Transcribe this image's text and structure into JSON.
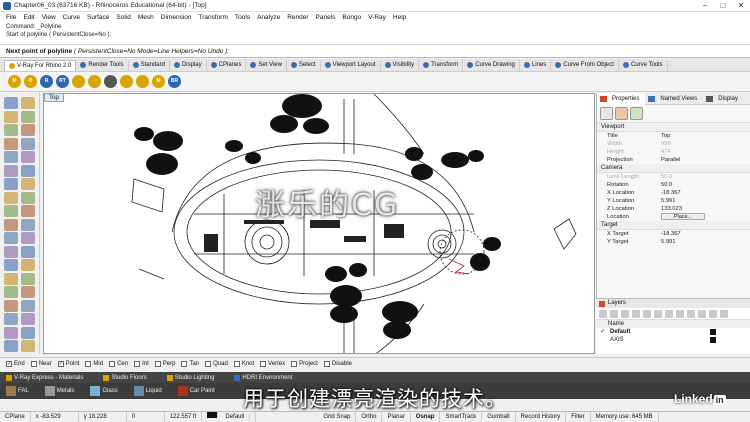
{
  "window": {
    "title": "Chapter06_03 (63716 KB) - Rhinoceros Educational (64-bit) - [Top]"
  },
  "menu": [
    "File",
    "Edit",
    "View",
    "Curve",
    "Surface",
    "Solid",
    "Mesh",
    "Dimension",
    "Transform",
    "Tools",
    "Analyze",
    "Render",
    "Panels",
    "Bongo",
    "V-Ray",
    "Help"
  ],
  "command_history": [
    "Command: _Polyline",
    "Start of polyline ( PersistentClose=No ):"
  ],
  "prompt": {
    "label": "Next point of polyline",
    "options": "( PersistentClose=No  Mode=Line  Helpers=No  Undo ):"
  },
  "toolbar_tabs": [
    {
      "label": "V-Ray For Rhino 2.0",
      "color": "#d9a400"
    },
    {
      "label": "Render Tools",
      "color": "#3a6fb5"
    },
    {
      "label": "Standard",
      "color": "#3a6fb5"
    },
    {
      "label": "Display",
      "color": "#3a6fb5"
    },
    {
      "label": "CPlanes",
      "color": "#3a6fb5"
    },
    {
      "label": "Set View",
      "color": "#3a6fb5"
    },
    {
      "label": "Select",
      "color": "#3a6fb5"
    },
    {
      "label": "Viewport Layout",
      "color": "#3a6fb5"
    },
    {
      "label": "Visibility",
      "color": "#3a6fb5"
    },
    {
      "label": "Transform",
      "color": "#3a6fb5"
    },
    {
      "label": "Curve Drawing",
      "color": "#3a6fb5"
    },
    {
      "label": "Lines",
      "color": "#3a6fb5"
    },
    {
      "label": "Curve From Object",
      "color": "#3a6fb5"
    },
    {
      "label": "Curve Tools",
      "color": "#3a6fb5"
    }
  ],
  "vray_icons": [
    {
      "label": "M",
      "color": "#d9a400"
    },
    {
      "label": "O",
      "color": "#d9a400"
    },
    {
      "label": "R",
      "color": "#2d68b3"
    },
    {
      "label": "RT",
      "color": "#2d68b3"
    },
    {
      "label": "",
      "color": "#d9a400"
    },
    {
      "label": "",
      "color": "#d9a400"
    },
    {
      "label": "",
      "color": "#555555"
    },
    {
      "label": "",
      "color": "#d9a400"
    },
    {
      "label": "",
      "color": "#d9a400"
    },
    {
      "label": "M",
      "color": "#d9a400"
    },
    {
      "label": "BR",
      "color": "#2d68b3"
    }
  ],
  "viewport": {
    "name": "Top"
  },
  "watermark": "涨乐的CG",
  "properties": {
    "tabs": [
      "Properties",
      "Named Views",
      "Display"
    ],
    "viewport_section": "Viewport",
    "viewport_rows": [
      {
        "k": "Title",
        "v": "Top",
        "dis": false
      },
      {
        "k": "Width",
        "v": "999",
        "dis": true
      },
      {
        "k": "Height",
        "v": "474",
        "dis": true
      },
      {
        "k": "Projection",
        "v": "Parallel",
        "dis": false
      }
    ],
    "camera_section": "Camera",
    "camera_rows": [
      {
        "k": "Lens Length",
        "v": "50.0",
        "dis": true
      },
      {
        "k": "Rotation",
        "v": "50.0",
        "dis": false
      },
      {
        "k": "X Location",
        "v": "-18.367",
        "dis": false
      },
      {
        "k": "Y Location",
        "v": "5.991",
        "dis": false
      },
      {
        "k": "Z Location",
        "v": "133.023",
        "dis": false
      }
    ],
    "location_label": "Location",
    "place_button": "Place...",
    "target_section": "Target",
    "target_rows": [
      {
        "k": "X Target",
        "v": "-18.367",
        "dis": false
      },
      {
        "k": "Y Target",
        "v": "5.991",
        "dis": false
      }
    ]
  },
  "layers": {
    "title": "Layers",
    "col": "Name",
    "rows": [
      {
        "name": "Default",
        "bold": true,
        "check": "✓"
      },
      {
        "name": "AXIS",
        "bold": false,
        "check": ""
      }
    ]
  },
  "osnaps": [
    {
      "label": "End",
      "checked": true
    },
    {
      "label": "Near",
      "checked": false
    },
    {
      "label": "Point",
      "checked": true
    },
    {
      "label": "Mid",
      "checked": false
    },
    {
      "label": "Cen",
      "checked": false
    },
    {
      "label": "Int",
      "checked": false
    },
    {
      "label": "Perp",
      "checked": false
    },
    {
      "label": "Tan",
      "checked": false
    },
    {
      "label": "Quad",
      "checked": false
    },
    {
      "label": "Knot",
      "checked": false
    },
    {
      "label": "Vertex",
      "checked": false
    },
    {
      "label": "Project",
      "checked": false
    },
    {
      "label": "Disable",
      "checked": false
    }
  ],
  "material_tabs": [
    {
      "label": "V-Ray Express - Materials",
      "color": "#d9a400"
    },
    {
      "label": "Studio Floors",
      "color": "#d9a400"
    },
    {
      "label": "Studio Lighting",
      "color": "#d9a400"
    },
    {
      "label": "HDRI Environment",
      "color": "#3a6fb5"
    }
  ],
  "materials": [
    {
      "label": "FAL",
      "color": "#9a7b4f"
    },
    {
      "label": "Metals",
      "color": "#999999"
    },
    {
      "label": "Glass",
      "color": "#7fb0d0"
    },
    {
      "label": "Liquid",
      "color": "#6a8aa5"
    },
    {
      "label": "Car Paint",
      "color": "#b03020"
    }
  ],
  "subtitle": "用于创建漂亮渲染的技术。",
  "status": {
    "cplane": "CPlane",
    "x": "x -83.529",
    "y": "y 18.228",
    "z": "0",
    "dist": "122.557 ft",
    "layer": "Default",
    "items": [
      "Grid Snap",
      "Ortho",
      "Planar",
      "Osnap",
      "SmartTrack",
      "Gumball",
      "Record History",
      "Filter"
    ],
    "memory": "Memory use: 645 MB"
  },
  "brand": "Linked"
}
